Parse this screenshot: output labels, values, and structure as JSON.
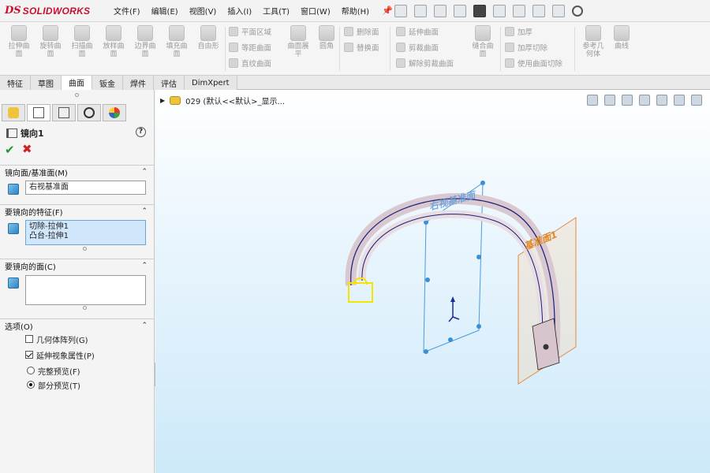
{
  "app": {
    "logo_ds": "DS",
    "logo_name": "SOLIDWORKS"
  },
  "menu": [
    {
      "label": "文件(F)"
    },
    {
      "label": "编辑(E)"
    },
    {
      "label": "视图(V)"
    },
    {
      "label": "插入(I)"
    },
    {
      "label": "工具(T)"
    },
    {
      "label": "窗口(W)"
    },
    {
      "label": "帮助(H)"
    }
  ],
  "ribbon": {
    "large": [
      {
        "label": "拉伸曲\n面"
      },
      {
        "label": "旋转曲\n面"
      },
      {
        "label": "扫描曲\n面"
      },
      {
        "label": "放样曲\n面"
      },
      {
        "label": "边界曲\n面"
      },
      {
        "label": "填充曲\n面"
      },
      {
        "label": "自由形"
      }
    ],
    "group2": [
      {
        "label": "平面区域"
      },
      {
        "label": "等距曲面"
      },
      {
        "label": "直纹曲面"
      }
    ],
    "surface_flatten": "曲面展\n平",
    "fillet": "圆角",
    "group3": [
      {
        "label": "删除面"
      },
      {
        "label": "替换面"
      }
    ],
    "group4": [
      {
        "label": "延伸曲面"
      },
      {
        "label": "剪裁曲面"
      },
      {
        "label": "解除剪裁曲面"
      }
    ],
    "knit": "缝合曲\n面",
    "group5": [
      {
        "label": "加厚"
      },
      {
        "label": "加厚切除"
      },
      {
        "label": "使用曲面切除"
      }
    ],
    "ref_geo": "参考几\n何体",
    "curves": "曲线"
  },
  "tabs": [
    {
      "label": "特征"
    },
    {
      "label": "草图"
    },
    {
      "label": "曲面"
    },
    {
      "label": "钣金"
    },
    {
      "label": "焊件"
    },
    {
      "label": "评估"
    },
    {
      "label": "DimXpert"
    }
  ],
  "active_tab": "曲面",
  "panel": {
    "feature_title": "镜向1",
    "help": "?",
    "ok": "✔",
    "cancel": "✖",
    "mirror_plane": {
      "header": "镜向面/基准面(M)",
      "value": "右视基准面"
    },
    "features": {
      "header": "要镜向的特征(F)",
      "items": [
        "切除-拉伸1",
        "凸台-拉伸1"
      ]
    },
    "faces": {
      "header": "要镜向的面(C)"
    },
    "options": {
      "header": "选项(O)",
      "geometry_pattern": {
        "label": "几何体阵列(G)",
        "checked": false
      },
      "propagate_visual": {
        "label": "延伸视象属性(P)",
        "checked": true
      },
      "full_preview": {
        "label": "完整预览(F)",
        "selected": false
      },
      "partial_preview": {
        "label": "部分预览(T)",
        "selected": true
      }
    }
  },
  "viewport": {
    "tree_item": "029  (默认<<默认>_显示...",
    "plane_label_1": "右视基准面",
    "plane_label_2": "基准面1"
  }
}
